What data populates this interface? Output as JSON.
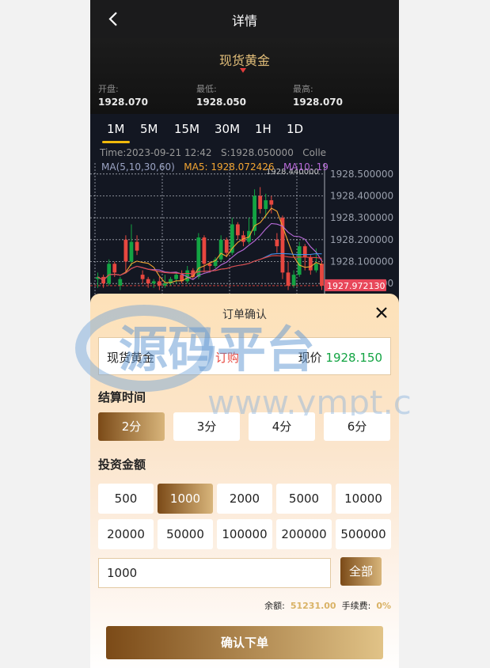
{
  "header": {
    "title": "详情"
  },
  "product": {
    "name": "现货黄金",
    "open_label": "开盘:",
    "open": "1928.070",
    "low_label": "最低:",
    "low": "1928.050",
    "high_label": "最高:",
    "high": "1928.070"
  },
  "chart": {
    "tabs": [
      "1M",
      "5M",
      "15M",
      "30M",
      "1H",
      "1D"
    ],
    "legend_time": "Time:2023-09-21 12:42",
    "legend_s": "S:1928.050000",
    "legend_extra": "Colle",
    "legend_ma": "MA(5,10,30,60)",
    "legend_ma5": "MA5: 1928.072426",
    "legend_ma10": "MA10: 19",
    "peak_label": "1928.440000",
    "last_price_label": "1927.972130"
  },
  "chart_data": {
    "type": "candlestick",
    "y_ticks": [
      "1928.500000",
      "1928.400000",
      "1928.300000",
      "1928.200000",
      "1928.100000",
      "1928.000000"
    ],
    "ylim": [
      1927.95,
      1928.55
    ],
    "grid": true,
    "candles": [
      {
        "o": 1928.02,
        "c": 1928.03,
        "h": 1928.05,
        "l": 1927.98
      },
      {
        "o": 1928.03,
        "c": 1928.0,
        "h": 1928.04,
        "l": 1927.98
      },
      {
        "o": 1928.0,
        "c": 1928.09,
        "h": 1928.11,
        "l": 1927.99
      },
      {
        "o": 1928.09,
        "c": 1928.05,
        "h": 1928.1,
        "l": 1928.03
      },
      {
        "o": 1927.99,
        "c": 1928.02,
        "h": 1928.03,
        "l": 1927.97
      },
      {
        "o": 1928.2,
        "c": 1928.1,
        "h": 1928.22,
        "l": 1928.05
      },
      {
        "o": 1928.1,
        "c": 1928.19,
        "h": 1928.27,
        "l": 1928.08
      },
      {
        "o": 1928.19,
        "c": 1928.15,
        "h": 1928.22,
        "l": 1928.13
      },
      {
        "o": 1928.04,
        "c": 1928.02,
        "h": 1928.06,
        "l": 1928.0
      },
      {
        "o": 1928.02,
        "c": 1928.0,
        "h": 1928.03,
        "l": 1927.98
      },
      {
        "o": 1928.0,
        "c": 1928.01,
        "h": 1928.02,
        "l": 1927.98
      },
      {
        "o": 1928.01,
        "c": 1927.99,
        "h": 1928.03,
        "l": 1927.97
      },
      {
        "o": 1927.99,
        "c": 1928.0,
        "h": 1928.04,
        "l": 1927.98
      },
      {
        "o": 1928.0,
        "c": 1928.02,
        "h": 1928.03,
        "l": 1927.99
      },
      {
        "o": 1928.02,
        "c": 1928.04,
        "h": 1928.05,
        "l": 1928.0
      },
      {
        "o": 1928.04,
        "c": 1928.01,
        "h": 1928.06,
        "l": 1928.0
      },
      {
        "o": 1928.01,
        "c": 1928.06,
        "h": 1928.08,
        "l": 1928.0
      },
      {
        "o": 1928.06,
        "c": 1928.03,
        "h": 1928.07,
        "l": 1928.02
      },
      {
        "o": 1928.03,
        "c": 1928.21,
        "h": 1928.23,
        "l": 1928.02
      },
      {
        "o": 1928.21,
        "c": 1928.09,
        "h": 1928.22,
        "l": 1928.05
      },
      {
        "o": 1928.09,
        "c": 1928.08,
        "h": 1928.1,
        "l": 1928.05
      },
      {
        "o": 1928.08,
        "c": 1928.11,
        "h": 1928.12,
        "l": 1928.07
      },
      {
        "o": 1928.11,
        "c": 1928.2,
        "h": 1928.22,
        "l": 1928.1
      },
      {
        "o": 1928.2,
        "c": 1928.14,
        "h": 1928.21,
        "l": 1928.12
      },
      {
        "o": 1928.14,
        "c": 1928.27,
        "h": 1928.3,
        "l": 1928.13
      },
      {
        "o": 1928.27,
        "c": 1928.22,
        "h": 1928.28,
        "l": 1928.2
      },
      {
        "o": 1928.22,
        "c": 1928.19,
        "h": 1928.24,
        "l": 1928.17
      },
      {
        "o": 1928.19,
        "c": 1928.24,
        "h": 1928.3,
        "l": 1928.18
      },
      {
        "o": 1928.24,
        "c": 1928.4,
        "h": 1928.43,
        "l": 1928.22
      },
      {
        "o": 1928.4,
        "c": 1928.34,
        "h": 1928.44,
        "l": 1928.32
      },
      {
        "o": 1928.34,
        "c": 1928.38,
        "h": 1928.41,
        "l": 1928.3
      },
      {
        "o": 1928.38,
        "c": 1928.36,
        "h": 1928.4,
        "l": 1928.32
      },
      {
        "o": 1928.2,
        "c": 1928.17,
        "h": 1928.23,
        "l": 1928.14
      },
      {
        "o": 1928.3,
        "c": 1928.05,
        "h": 1928.31,
        "l": 1928.02
      },
      {
        "o": 1928.05,
        "c": 1927.99,
        "h": 1928.1,
        "l": 1927.97
      },
      {
        "o": 1927.99,
        "c": 1928.04,
        "h": 1928.06,
        "l": 1927.98
      },
      {
        "o": 1928.04,
        "c": 1928.17,
        "h": 1928.19,
        "l": 1928.03
      },
      {
        "o": 1928.17,
        "c": 1928.12,
        "h": 1928.18,
        "l": 1928.06
      },
      {
        "o": 1928.12,
        "c": 1928.06,
        "h": 1928.13,
        "l": 1928.04
      },
      {
        "o": 1928.06,
        "c": 1928.09,
        "h": 1928.16,
        "l": 1928.05
      },
      {
        "o": 1928.09,
        "c": 1927.99,
        "h": 1928.11,
        "l": 1927.97
      }
    ]
  },
  "order": {
    "title": "订单确认",
    "product_name": "现货黄金",
    "direction": "订购",
    "price_label": "现价",
    "price": "1928.150",
    "settle_label": "结算时间",
    "settle_options": [
      "2分",
      "3分",
      "4分",
      "6分"
    ],
    "settle_selected": 0,
    "invest_label": "投资金额",
    "amount_options": [
      "500",
      "1000",
      "2000",
      "5000",
      "10000",
      "20000",
      "50000",
      "100000",
      "200000",
      "500000"
    ],
    "amount_selected": 1,
    "amount_value": "1000",
    "all_label": "全部",
    "balance_label": "余额:",
    "balance": "51231.00",
    "fee_label": "手续费:",
    "fee": "0%",
    "confirm_label": "确认下单"
  },
  "watermark": {
    "text": "源码平台",
    "url": "www.ympt.cc"
  },
  "colors": {
    "up": "#13a443",
    "down": "#e7473f",
    "gold": "#d8b57b",
    "tab_underline": "#f0b90b"
  }
}
